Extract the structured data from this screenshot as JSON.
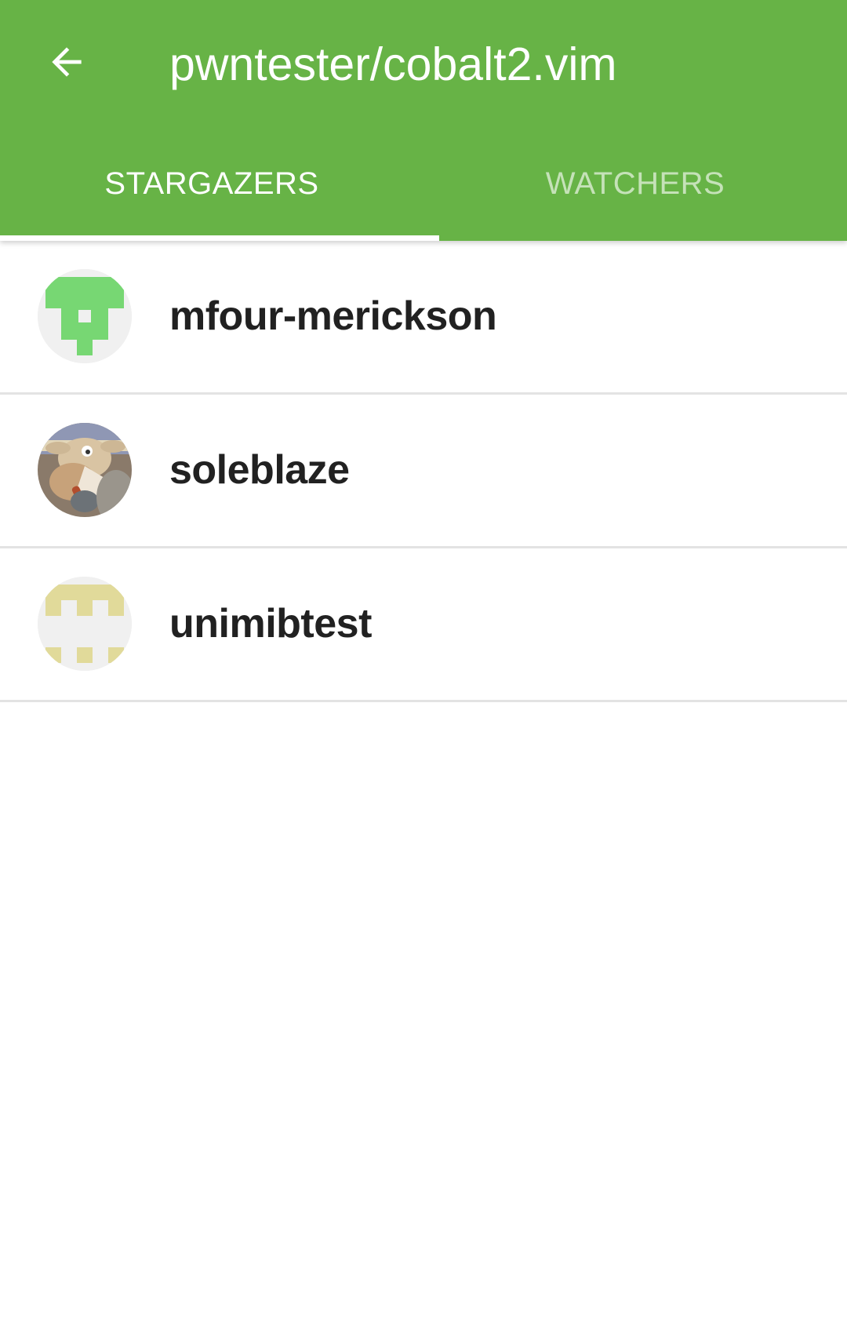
{
  "appbar": {
    "title": "pwntester/cobalt2.vim",
    "back_icon": "arrow-back-icon",
    "background_color": "#67b346"
  },
  "tabs": [
    {
      "label": "STARGAZERS",
      "active": true
    },
    {
      "label": "WATCHERS",
      "active": false
    }
  ],
  "users": [
    {
      "name": "mfour-merickson",
      "avatar": "identicon-green"
    },
    {
      "name": "soleblaze",
      "avatar": "cartoon-photo"
    },
    {
      "name": "unimibtest",
      "avatar": "identicon-yellow"
    }
  ]
}
